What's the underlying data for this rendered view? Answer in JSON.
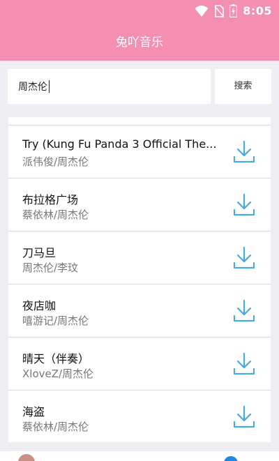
{
  "statusbar": {
    "time": "8:05",
    "icons": [
      "wifi-icon",
      "no-sim-icon",
      "battery-charging-icon"
    ]
  },
  "app": {
    "title": "兔吖音乐"
  },
  "search": {
    "value": "周杰伦",
    "button_label": "搜索"
  },
  "songs": [
    {
      "title": "Try (Kung Fu Panda 3 Official The...",
      "artist": "派伟俊/周杰伦"
    },
    {
      "title": "布拉格广场",
      "artist": "蔡依林/周杰伦"
    },
    {
      "title": "刀马旦",
      "artist": "周杰伦/李玟"
    },
    {
      "title": "夜店咖",
      "artist": "嘻游记/周杰伦"
    },
    {
      "title": "晴天（伴奏）",
      "artist": "XloveZ/周杰伦"
    },
    {
      "title": "海盗",
      "artist": "蔡依林/周杰伦"
    }
  ],
  "colors": {
    "header": "#f48fb1",
    "download_icon": "#4aa9e0",
    "background": "#efeff3"
  }
}
